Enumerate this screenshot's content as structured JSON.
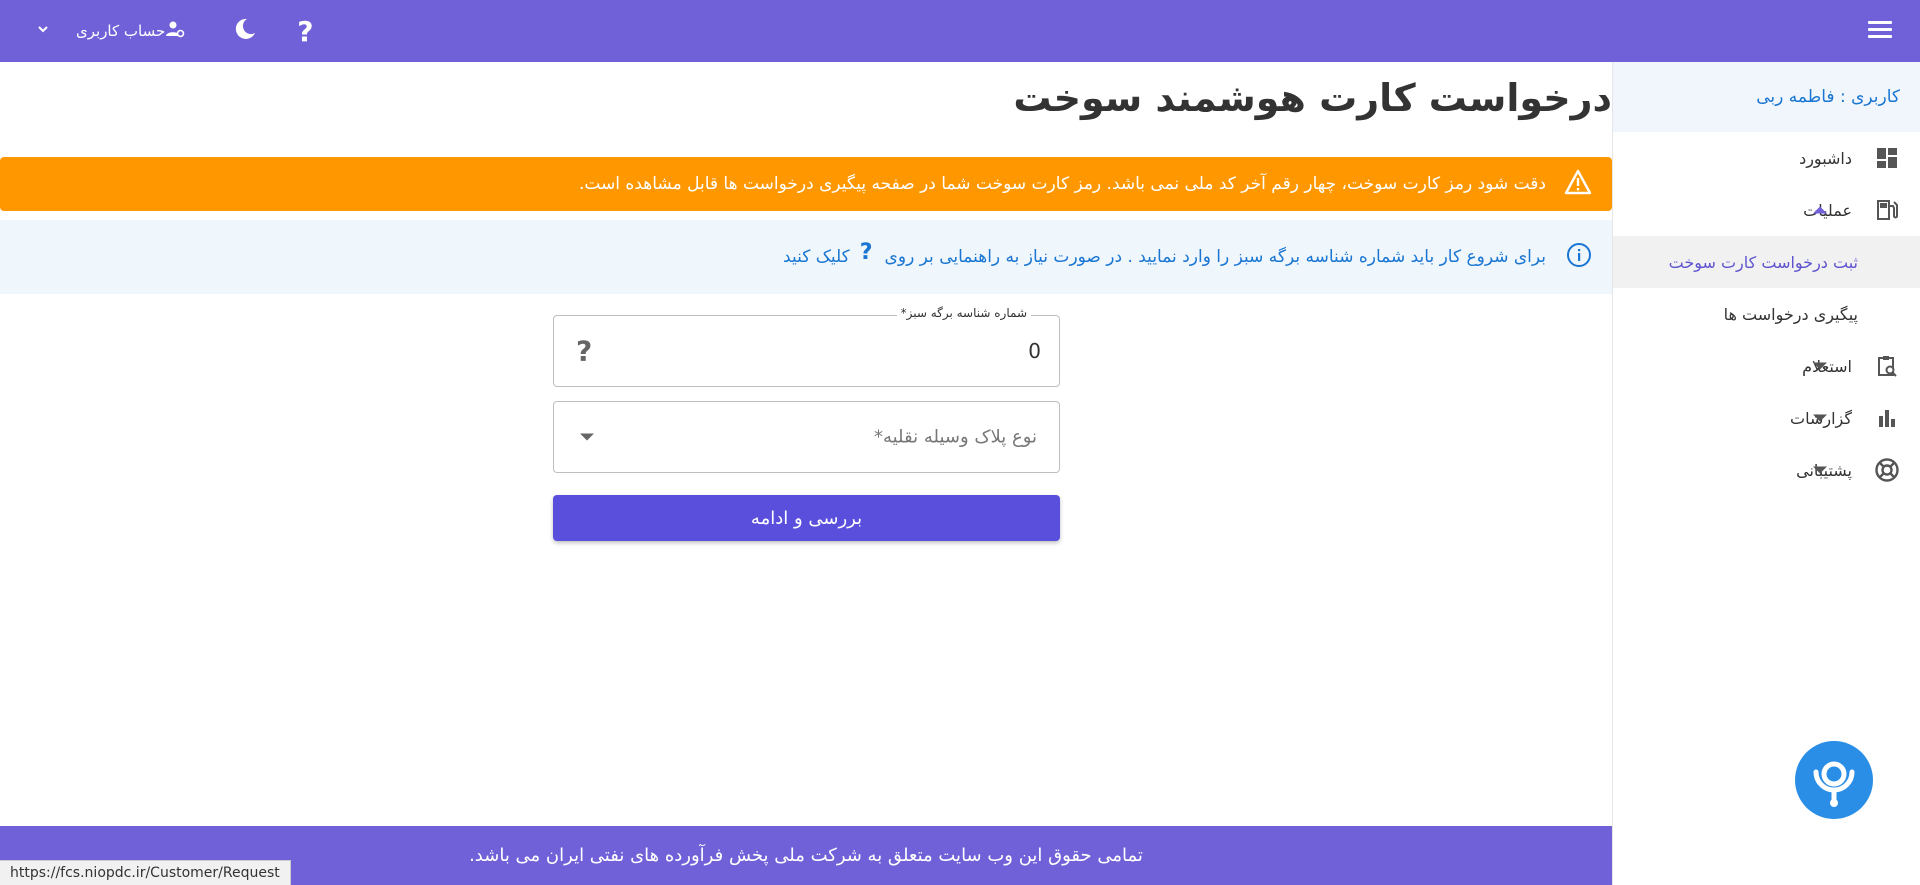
{
  "topbar": {
    "account_label": "حساب کاربری",
    "help_label": "?",
    "icons": [
      "menu-icon",
      "user-gear-icon",
      "moon-icon",
      "help-icon",
      "chevron-down-icon"
    ],
    "color": "#7161d9"
  },
  "sidebar": {
    "user_label": "کاربری : فاطمه ربی",
    "items": [
      {
        "label": "داشبورد",
        "icon": "dashboard-icon"
      },
      {
        "label": "عملیات",
        "icon": "fuel-pump-icon",
        "expanded": true
      },
      {
        "label": "استعلام",
        "icon": "clipboard-search-icon"
      },
      {
        "label": "گزارشات",
        "icon": "bar-chart-icon"
      },
      {
        "label": "پشتیبانی",
        "icon": "lifebuoy-icon"
      }
    ],
    "subitems": [
      {
        "label": "ثبت درخواست کارت سوخت",
        "active": true
      },
      {
        "label": "پیگیری درخواست ها"
      }
    ]
  },
  "main": {
    "title": "درخواست کارت هوشمند سوخت",
    "warning": "دقت شود رمز کارت سوخت، چهار رقم آخر کد ملی نمی باشد. رمز کارت سوخت شما در صفحه پیگیری درخواست ها قابل مشاهده است.",
    "info_text": "برای شروع کار باید شماره شناسه برگه سبز را وارد نمایید . در صورت نیاز به راهنمایی بر روی",
    "info_help": "?",
    "info_suffix": "کلیک کنید",
    "warning_color": "#ff9800"
  },
  "form": {
    "green_id_label": "شماره شناسه برگه سبز*",
    "green_id_value": "0",
    "field_help": "?",
    "plate_type_placeholder": "نوع پلاک وسیله نقلیه*",
    "submit_label": "بررسی و ادامه",
    "button_color": "#5a4fdc"
  },
  "footer": {
    "text": "تمامی حقوق این وب سایت متعلق به شرکت ملی پخش فرآورده های نفتی ایران می باشد."
  },
  "status_bar": {
    "url": "https://fcs.niopdc.ir/Customer/Request"
  }
}
